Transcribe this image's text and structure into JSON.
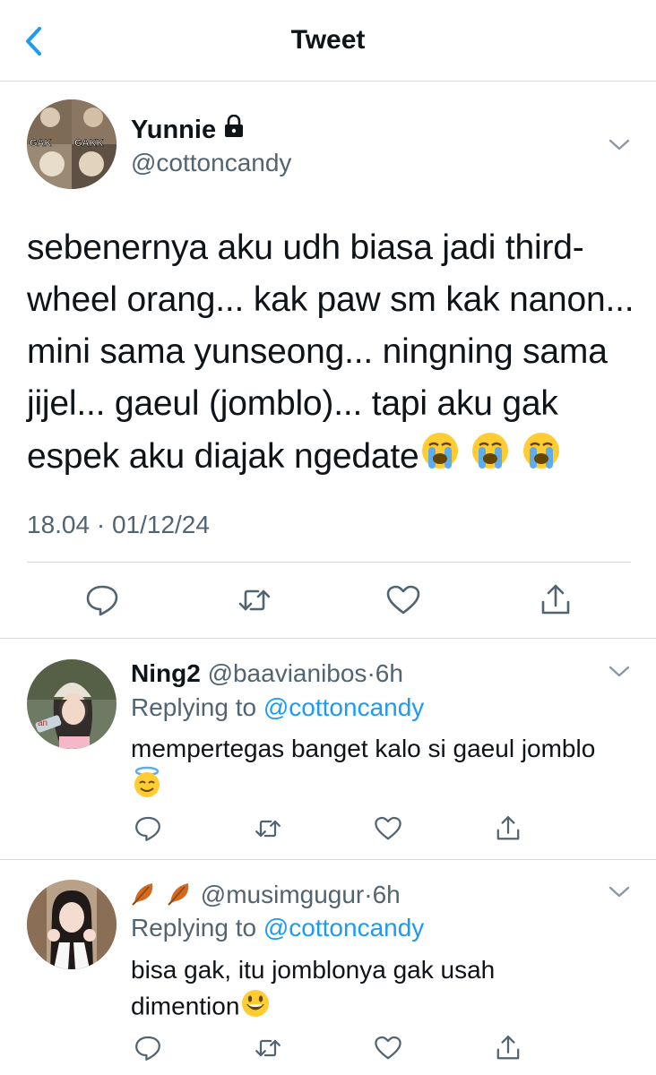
{
  "header": {
    "title": "Tweet",
    "back_icon": "chevron-left-icon"
  },
  "colors": {
    "accent": "#1d9bf0",
    "secondary_text": "#536471",
    "divider": "#d5d9dc"
  },
  "main_tweet": {
    "display_name": "Yunnie",
    "handle": "@cottoncandy",
    "avatar_text_left": "GAK",
    "avatar_text_right": "GAKK",
    "text": "sebenernya aku udh biasa jadi third-wheel orang... kak paw sm kak nanon... mini sama yunseong... ningning sama jijel... gaeul (jomblo)... tapi aku gak espek aku diajak ngedate",
    "text_lines": [
      "sebenernya aku udh biasa jadi third-",
      "wheel orang... kak paw sm kak nanon...",
      "mini sama yunseong... ningning sama",
      "jijel... gaeul (jomblo)... tapi aku gak",
      "espek aku diajak ngedate"
    ],
    "emojis": [
      "loudly-crying-face",
      "loudly-crying-face",
      "loudly-crying-face"
    ],
    "timestamp": "18.04 · 01/12/24"
  },
  "replies": [
    {
      "display_name": "Ning2",
      "handle": "@baavianibos",
      "dot": "·",
      "time": "6h",
      "replying_label": "Replying to",
      "replying_to": "@cottoncandy",
      "text_line1": "mempertegas banget kalo si gaeul jomblo",
      "text_line2": "",
      "emoji": "smiling-face-with-halo"
    },
    {
      "display_name": "",
      "name_emojis": [
        "fallen-leaf",
        "fallen-leaf"
      ],
      "handle": "@musimgugur",
      "dot": "·",
      "time": "6h",
      "replying_label": "Replying to",
      "replying_to": "@cottoncandy",
      "text_line1": "bisa gak, itu jomblonya gak usah",
      "text_line2": "dimention",
      "emoji": "grinning-face-with-big-eyes"
    }
  ]
}
